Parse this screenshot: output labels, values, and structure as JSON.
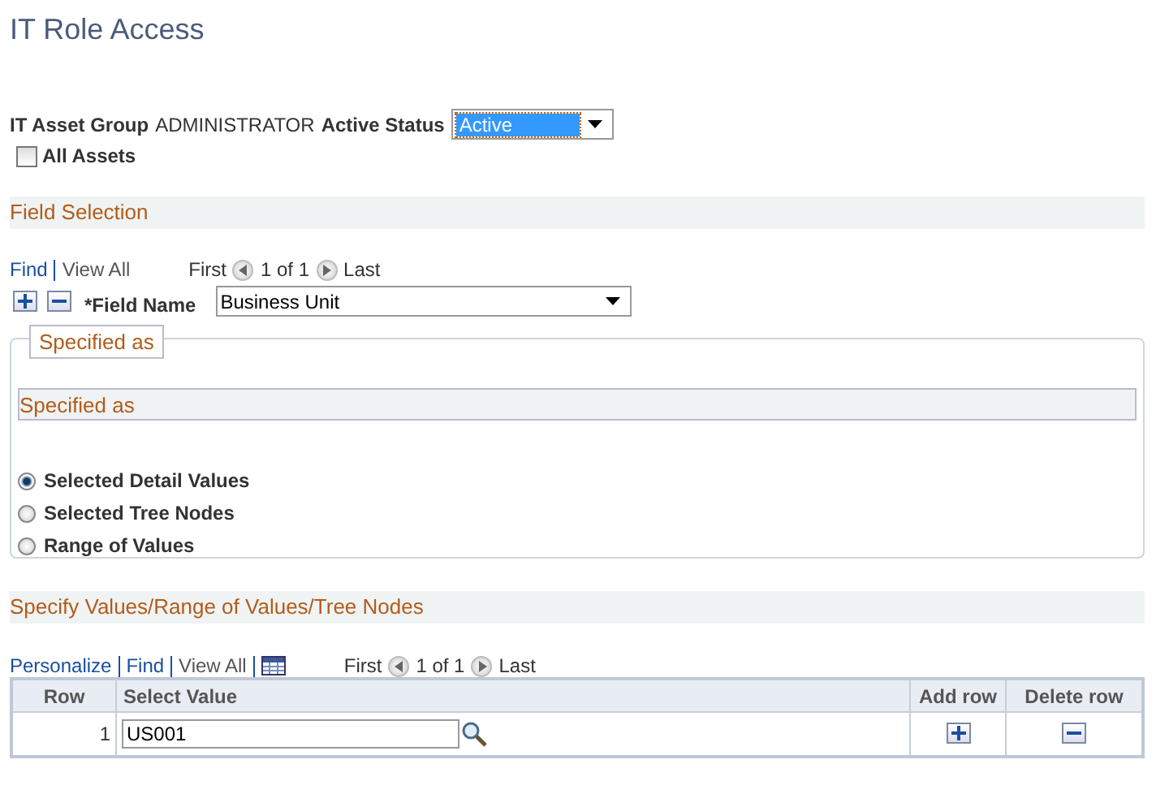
{
  "page_title": "IT Role Access",
  "header": {
    "group_label": "IT Asset Group",
    "group_value": "ADMINISTRATOR",
    "status_label": "Active Status",
    "status_value": "Active",
    "all_assets": {
      "label": "All Assets",
      "checked": false
    }
  },
  "field_selection": {
    "title": "Field Selection",
    "nav": {
      "find": "Find",
      "view_all": "View All",
      "first": "First",
      "count": "1 of 1",
      "last": "Last"
    },
    "field_label": "*Field Name",
    "field_value": "Business Unit",
    "group_title": "Specified as",
    "section_title": "Specified as",
    "options": [
      {
        "label": "Selected Detail Values",
        "selected": true
      },
      {
        "label": "Selected Tree Nodes",
        "selected": false
      },
      {
        "label": "Range of Values",
        "selected": false
      }
    ]
  },
  "values_section": {
    "title": "Specify Values/Range of Values/Tree Nodes",
    "nav": {
      "personalize": "Personalize",
      "find": "Find",
      "view_all": "View All",
      "first": "First",
      "count": "1 of 1",
      "last": "Last"
    },
    "columns": [
      "Row",
      "Select Value",
      "Add row",
      "Delete row"
    ],
    "rows": [
      {
        "row": "1",
        "value": "US001"
      }
    ]
  }
}
